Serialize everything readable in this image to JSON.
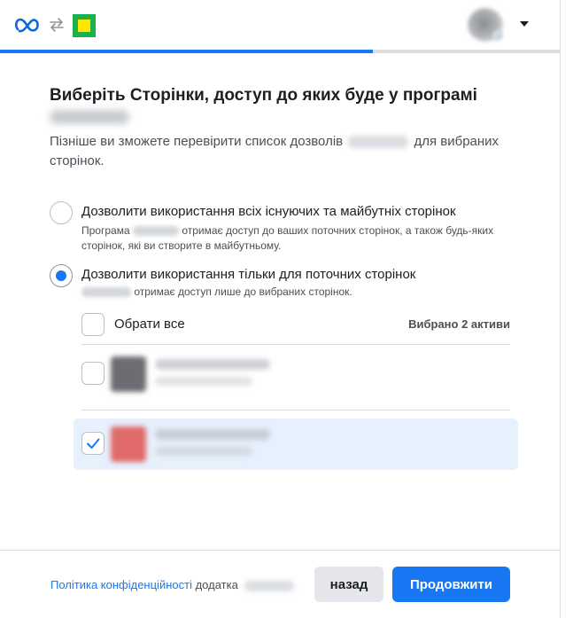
{
  "header": {
    "icons": [
      "meta-logo-icon",
      "swap-arrows-icon",
      "app-icon",
      "avatar",
      "caret-down-icon"
    ],
    "progress": 0.665
  },
  "main": {
    "title": "Виберіть Сторінки, доступ до яких буде у програмі",
    "subtitle_before": "Пізніше ви зможете перевірити список дозволів",
    "subtitle_after": "для вибраних сторінок.",
    "option_all": {
      "label": "Дозволити використання всіх існуючих та майбутніх сторінок",
      "desc_before": "Програма",
      "desc_after": "отримає доступ до ваших поточних сторінок, а також будь-яких сторінок, які ви створите в майбутньому.",
      "selected": false
    },
    "option_current": {
      "label": "Дозволити використання тільки для поточних сторінок",
      "desc_after": "отримає доступ лише до вибраних сторінок.",
      "selected": true
    },
    "select_all_label": "Обрати все",
    "selected_count_label": "Вибрано 2 активи",
    "pages": [
      {
        "checked": false,
        "thumb_color": "#6b6d72"
      },
      {
        "checked": true,
        "thumb_color": "#e06060"
      }
    ]
  },
  "footer": {
    "privacy_link": "Політика конфіденційності",
    "privacy_suffix": "додатка",
    "back_label": "назад",
    "continue_label": "Продовжити"
  },
  "colors": {
    "accent": "#1877f2",
    "selected_row": "#e7f0fd"
  }
}
